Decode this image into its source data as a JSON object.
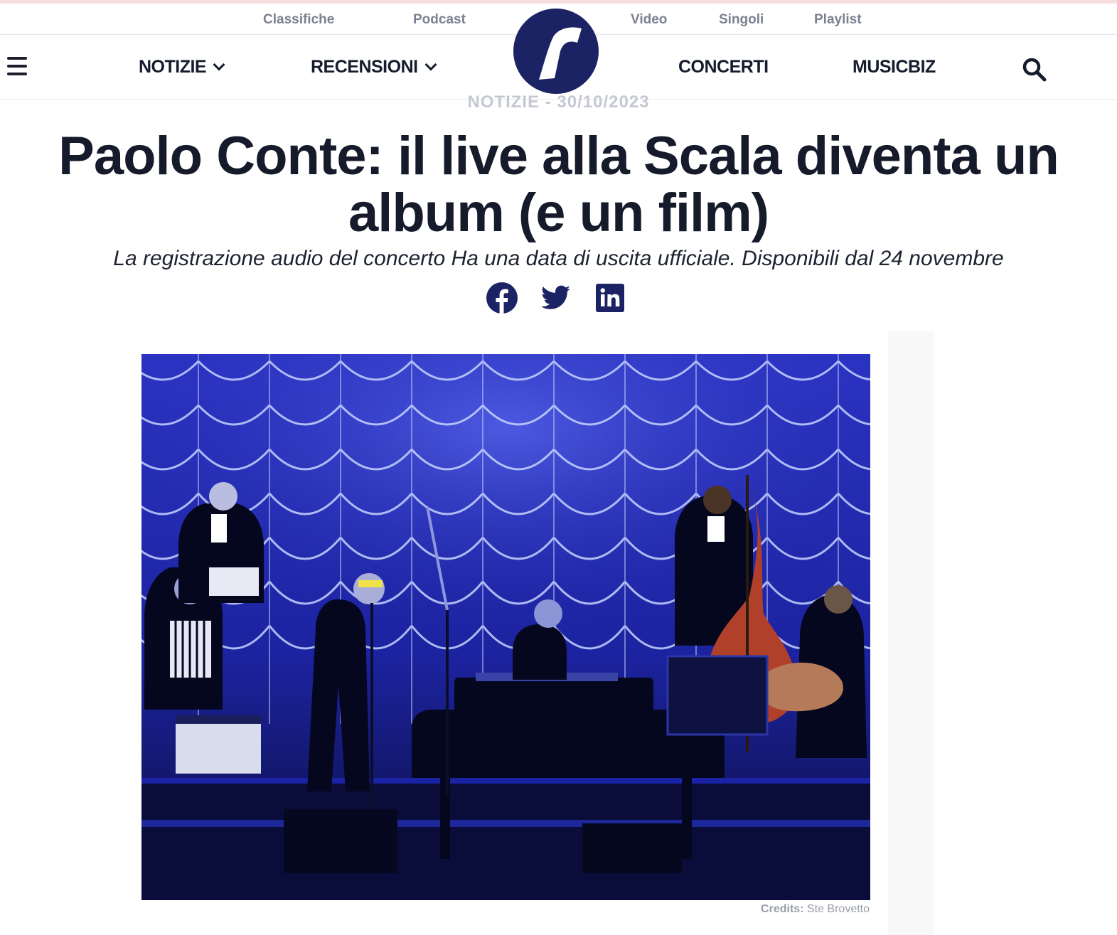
{
  "top_nav": {
    "links": [
      "Classifiche",
      "Podcast",
      "Video",
      "Singoli",
      "Playlist"
    ]
  },
  "main_nav": {
    "notizie": "NOTIZIE",
    "recensioni": "RECENSIONI",
    "concerti": "CONCERTI",
    "musicbiz": "MUSICBIZ"
  },
  "logo": {
    "text": "rockol",
    "colors": {
      "bg": "#1c2364",
      "fg": "#ffffff"
    }
  },
  "article": {
    "kicker": "NOTIZIE - 30/10/2023",
    "title": "Paolo Conte: il live alla Scala diventa un album (e un film)",
    "subtitle": "La registrazione audio del concerto Ha una data di uscita ufficiale. Disponibili dal 24 novembre",
    "share": [
      "facebook-icon",
      "twitter-icon",
      "linkedin-icon"
    ],
    "credits_label": "Credits:",
    "credits_name": "Ste Brovetto"
  },
  "colors": {
    "text": "#161b2b",
    "muted": "#7c8090",
    "brand": "#1c2364",
    "stage_blue": "#2a35c8"
  }
}
